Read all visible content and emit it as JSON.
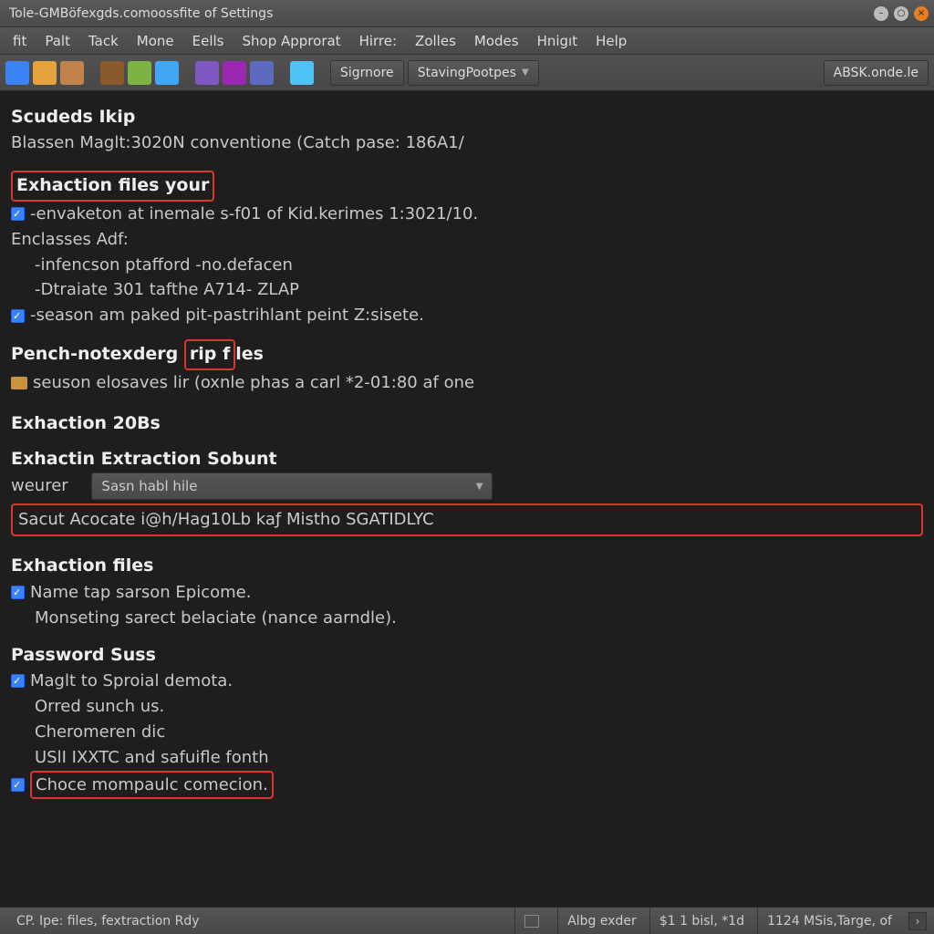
{
  "window": {
    "title": "Tole-GMBöfexgds.comoossfite of Settings"
  },
  "menubar": [
    "fit",
    "Palt",
    "Tack",
    "Mone",
    "Eells",
    "Shop Approrat",
    "Hirre:",
    "Zolles",
    "Modes",
    "Hnigıt",
    "Help"
  ],
  "toolbar": {
    "btn1": "Sigrnore",
    "btn2": "StavingPootpes",
    "btn3": "ABSK.onde.le"
  },
  "content": {
    "h_scudeds": "Scudeds Ikip",
    "blassen": "Blassen Maglt:3020N conventione (Catch pase: 186A1/",
    "h_exhaction_your": "Exhaction files your",
    "l_envaketon": "-envaketon at inemale s-f01 of Kid.kerimes 1:3021/10.",
    "l_enclasses": "Enclasses Adf:",
    "l_infencson": "-infencson ptafford -no.defacen",
    "l_dtraiate": "-Dtraiate 301 tafthe A714- ZLAP",
    "l_season_paked": "-season am paked pit-pastrihlant peint Z:sisete.",
    "h_pench_pre": "Pench-notexderg ",
    "h_pench_red": "rip f",
    "h_pench_post": "les",
    "l_seuson": "seuson elosaves lir (oxnle phas a carl *2-01:80 af one",
    "h_exhaction_20bs": "Exhaction 20Bs",
    "h_extraction_sobunt": "Exhactin Extraction Sobunt",
    "weurer_label": "weurer",
    "dropdown_value": "Sasn habl hile",
    "sacut_line": "Sacut Acocate i@h/Hag10Lb kaƒ Mistho SGATIDLYC",
    "h_exhaction_files": "Exhaction files",
    "l_name_tap": "Name tap sarson Epicome.",
    "l_monseting": "Monseting sarect belaciate (nance aarndle).",
    "h_password": "Password Suss",
    "l_maglt": "Maglt to Sproial demota.",
    "l_orred": "Orred sunch us.",
    "l_cheromeren": "Cheromeren dic",
    "l_usli": "USlI IXXTC and safuifle fonth",
    "l_choce": "Choce mompaulc comecion."
  },
  "statusbar": {
    "left": "CP. Ipe: files, fextraction Rdy",
    "s1": "Albg exder",
    "s2": "$1 1 bisl, *1d",
    "s3": "1124 MSis,Targe, of"
  }
}
